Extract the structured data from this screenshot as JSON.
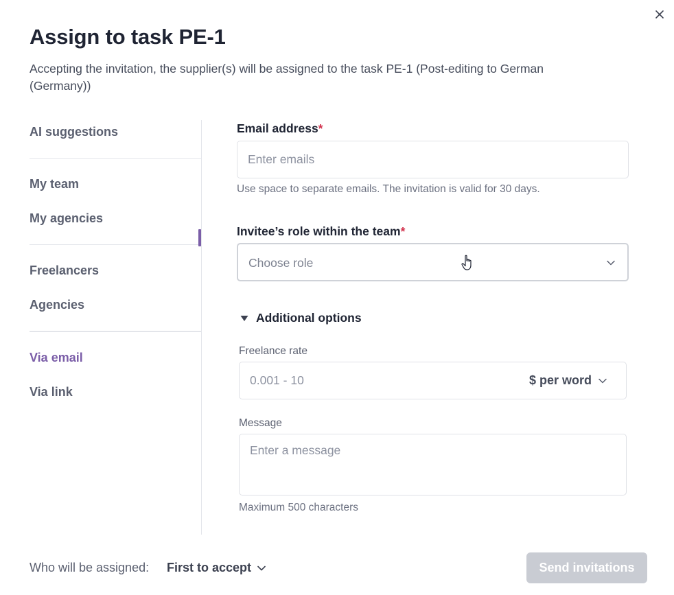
{
  "dialog": {
    "title": "Assign to task PE-1",
    "subtitle": "Accepting the invitation, the supplier(s) will be assigned to the task PE-1 (Post-editing to German (Germany))"
  },
  "sidebar": {
    "items": [
      {
        "label": "AI suggestions"
      },
      {
        "label": "My team"
      },
      {
        "label": "My agencies"
      },
      {
        "label": "Freelancers"
      },
      {
        "label": "Agencies"
      },
      {
        "label": "Via email",
        "active": true
      },
      {
        "label": "Via link"
      }
    ]
  },
  "form": {
    "email_label": "Email address",
    "required_mark": "*",
    "email_placeholder": "Enter emails",
    "email_hint": "Use space to separate emails. The invitation is valid for 30 days.",
    "role_label": "Invitee’s role within the team",
    "role_placeholder": "Choose role",
    "additional_options": "Additional options",
    "rate_label": "Freelance rate",
    "rate_placeholder": "0.001 - 10",
    "rate_unit": "$ per word",
    "message_label": "Message",
    "message_placeholder": "Enter a message",
    "message_hint": "Maximum 500 characters"
  },
  "footer": {
    "assign_label": "Who will be assigned:",
    "assign_value": "First to accept",
    "send_button": "Send invitations"
  },
  "colors": {
    "accent": "#7b5ea8",
    "required": "#d12f4a",
    "disabled_button": "#c9ccd3"
  }
}
